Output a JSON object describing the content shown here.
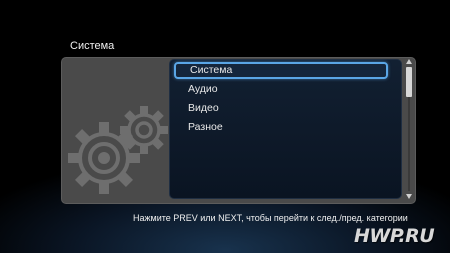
{
  "header": {
    "title": "Система"
  },
  "menu": {
    "items": [
      {
        "label": "Система",
        "selected": true
      },
      {
        "label": "Аудио",
        "selected": false
      },
      {
        "label": "Видео",
        "selected": false
      },
      {
        "label": "Разное",
        "selected": false
      }
    ]
  },
  "footer": {
    "hint": "Нажмите PREV или NEXT, чтобы перейти к след./пред. категории"
  },
  "watermark": {
    "text": "HWP.RU"
  },
  "colors": {
    "selection_border": "#5aa6e6",
    "panel_background": "#4a4a4a",
    "menu_background": "#122032"
  },
  "icons": {
    "category_icon": "gears-icon"
  }
}
